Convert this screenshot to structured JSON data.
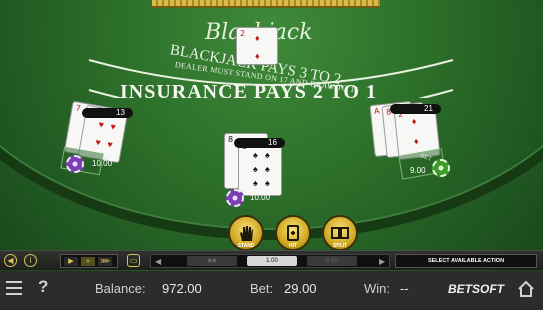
{
  "table": {
    "title": "Blackjack",
    "payout_line": "BLACKJACK PAYS 3 TO 2",
    "dealer_rule": "DEALER MUST STAND ON 17 AND DRAW TO 16",
    "insurance_line": "INSURANCE PAYS 2 TO 1"
  },
  "dealer": {
    "card": {
      "rank": "2",
      "suit": "diamonds"
    }
  },
  "hands": [
    {
      "score": "13",
      "bet": "10.00",
      "cards": [
        {
          "rank": "7",
          "suit": "diamonds"
        },
        {
          "rank": "6",
          "suit": "hearts"
        }
      ]
    },
    {
      "score": "16",
      "bet": "10.00",
      "cards": [
        {
          "rank": "8",
          "suit": "clubs"
        },
        {
          "rank": "8",
          "suit": "spades"
        }
      ]
    },
    {
      "score": "21",
      "bet": "9.00",
      "badge": "BET",
      "cards": [
        {
          "rank": "A",
          "suit": "hearts"
        },
        {
          "rank": "8",
          "suit": "diamonds"
        },
        {
          "rank": "2",
          "suit": "diamonds"
        }
      ]
    }
  ],
  "actions": [
    {
      "label": "STAND",
      "icon": "hand-icon"
    },
    {
      "label": "HIT",
      "icon": "hit-card-icon"
    },
    {
      "label": "SPLIT",
      "icon": "split-cards-icon"
    }
  ],
  "toolbar": {
    "chip_values": [
      "1.00",
      "5.00"
    ],
    "status": "SELECT AVAILABLE ACTION"
  },
  "footer": {
    "balance_label": "Balance:",
    "balance_value": "972.00",
    "bet_label": "Bet:",
    "bet_value": "29.00",
    "win_label": "Win:",
    "win_value": "--",
    "brand": "BETSOFT"
  },
  "colors": {
    "felt": "#2c6f2a",
    "gold": "#d1a923",
    "red_suit": "#c21b1b"
  }
}
